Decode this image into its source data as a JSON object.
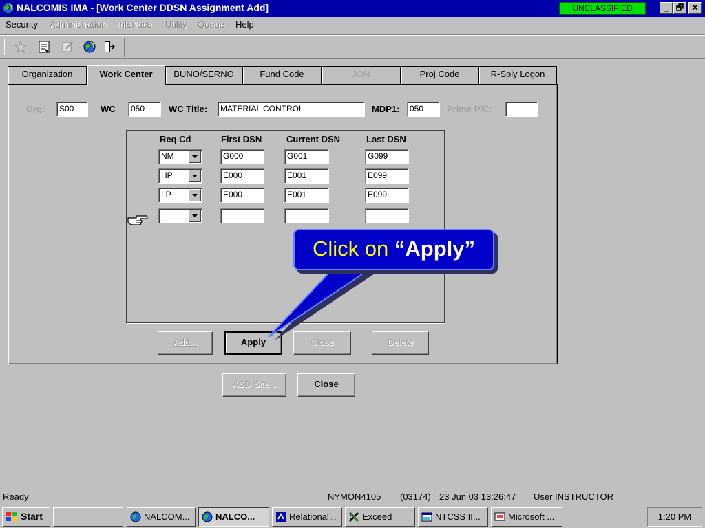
{
  "window": {
    "title": "NALCOMIS IMA - [Work Center DDSN Assignment Add]",
    "classification": "UNCLASSIFIED",
    "minimize_glyph": "_",
    "restore_glyph": "🗗",
    "close_glyph": "✕"
  },
  "menu": [
    "Security",
    "Administration",
    "Interface",
    "Utility",
    "Queue",
    "Help"
  ],
  "toolbar": {
    "icons": [
      "star-icon",
      "document-icon",
      "edit-icon",
      "globe-icon",
      "exit-door-icon"
    ]
  },
  "tabs": [
    {
      "label": "Organization",
      "state": "normal"
    },
    {
      "label": "Work Center",
      "state": "active"
    },
    {
      "label": "BUNO/SERNO",
      "state": "normal"
    },
    {
      "label": "Fund Code",
      "state": "normal"
    },
    {
      "label": "JON",
      "state": "disabled"
    },
    {
      "label": "Proj Code",
      "state": "normal"
    },
    {
      "label": "R-Sply Logon",
      "state": "normal"
    }
  ],
  "header_fields": {
    "org_label": "Org:",
    "org_value": "S00",
    "wc_label": "WC",
    "wc_value": "050",
    "wc_title_label": "WC Title:",
    "wc_title_value": "MATERIAL CONTROL",
    "mdp1_label": "MDP1:",
    "mdp1_value": "050",
    "prime_pc_label": "Prime P/C:",
    "prime_pc_value": ""
  },
  "grid": {
    "columns": [
      "Req Cd",
      "First DSN",
      "Current DSN",
      "Last DSN"
    ],
    "rows": [
      {
        "req_cd": "NM",
        "first_dsn": "G000",
        "current_dsn": "G001",
        "last_dsn": "G099"
      },
      {
        "req_cd": "HP",
        "first_dsn": "E000",
        "current_dsn": "E001",
        "last_dsn": "E099"
      },
      {
        "req_cd": "LP",
        "first_dsn": "E000",
        "current_dsn": "E001",
        "last_dsn": "E099"
      },
      {
        "req_cd": "|",
        "first_dsn": "",
        "current_dsn": "",
        "last_dsn": ""
      }
    ],
    "row_pointer_icon": "pointing-hand-icon"
  },
  "buttons": {
    "add": "Add...",
    "apply": "Apply",
    "close_inner": "Close",
    "delete": "Delete",
    "asd_site": "ASD Site...",
    "close": "Close"
  },
  "callout": {
    "lead": "Click on ",
    "target": "“Apply”"
  },
  "status": {
    "state": "Ready",
    "host": "NYMON4105",
    "session": "(03174)",
    "datetime": "23 Jun 03  13:26:47",
    "user": "User INSTRUCTOR"
  },
  "taskbar": {
    "start": "Start",
    "items": [
      {
        "label": "",
        "icon": ""
      },
      {
        "label": "NALCOM...",
        "icon": "globe-icon"
      },
      {
        "label": "NALCO...",
        "icon": "globe-icon",
        "active": true
      },
      {
        "label": "Relational...",
        "icon": "app-icon"
      },
      {
        "label": "Exceed",
        "icon": "exceed-icon"
      },
      {
        "label": "NTCSS II...",
        "icon": "window-icon"
      },
      {
        "label": "Microsoft ...",
        "icon": "presentation-icon"
      }
    ],
    "clock": "1:20 PM"
  },
  "colors": {
    "title_bar": "#0000a8",
    "classification_bg": "#00e000",
    "callout_bg": "#0000c8",
    "callout_lead": "#ffff00"
  }
}
